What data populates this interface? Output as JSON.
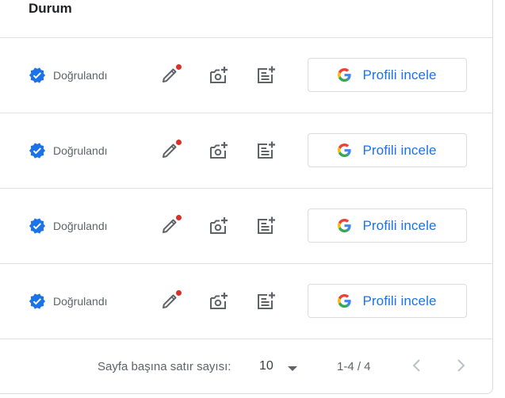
{
  "header": {
    "title": "Durum"
  },
  "rows": [
    {
      "status": "Doğrulandı",
      "button_label": "Profili incele"
    },
    {
      "status": "Doğrulandı",
      "button_label": "Profili incele"
    },
    {
      "status": "Doğrulandı",
      "button_label": "Profili incele"
    },
    {
      "status": "Doğrulandı",
      "button_label": "Profili incele"
    }
  ],
  "icons": {
    "status": "verified-check-icon",
    "edit": "pencil-edit-icon",
    "photo": "add-photo-icon",
    "post": "add-post-icon",
    "brand": "google-g-icon"
  },
  "footer": {
    "rows_per_page_label": "Sayfa başına satır sayısı:",
    "rows_per_page_value": "10",
    "range": "1-4 / 4"
  },
  "colors": {
    "accent": "#1a73e8",
    "notification_dot": "#d93025",
    "icon": "#5f6368",
    "divider": "#e0e0e0"
  }
}
